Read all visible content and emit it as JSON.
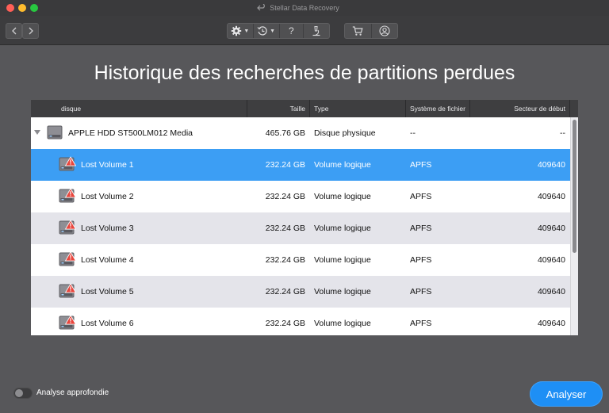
{
  "window": {
    "title": "Stellar Data Recovery"
  },
  "toolbar": {
    "back_icon": "chevron-left-icon",
    "forward_icon": "chevron-right-icon",
    "settings_icon": "gear-icon",
    "history_icon": "history-clock-icon",
    "help_label": "?",
    "tools_icon": "microscope-icon",
    "cart_icon": "cart-icon",
    "account_icon": "user-icon"
  },
  "page": {
    "heading": "Historique des recherches de partitions perdues"
  },
  "table": {
    "columns": [
      "disque",
      "Taille",
      "Type",
      "Système de fichier",
      "Secteur de début"
    ],
    "rows": [
      {
        "name": "APPLE HDD ST500LM012 Media",
        "size": "465.76 GB",
        "type": "Disque physique",
        "fs": "--",
        "start": "--",
        "kind": "disk",
        "selected": false
      },
      {
        "name": "Lost Volume 1",
        "size": "232.24 GB",
        "type": "Volume logique",
        "fs": "APFS",
        "start": "409640",
        "kind": "volume",
        "selected": true
      },
      {
        "name": "Lost Volume 2",
        "size": "232.24 GB",
        "type": "Volume logique",
        "fs": "APFS",
        "start": "409640",
        "kind": "volume",
        "selected": false
      },
      {
        "name": "Lost Volume 3",
        "size": "232.24 GB",
        "type": "Volume logique",
        "fs": "APFS",
        "start": "409640",
        "kind": "volume",
        "selected": false
      },
      {
        "name": "Lost Volume 4",
        "size": "232.24 GB",
        "type": "Volume logique",
        "fs": "APFS",
        "start": "409640",
        "kind": "volume",
        "selected": false
      },
      {
        "name": "Lost Volume 5",
        "size": "232.24 GB",
        "type": "Volume logique",
        "fs": "APFS",
        "start": "409640",
        "kind": "volume",
        "selected": false
      },
      {
        "name": "Lost Volume 6",
        "size": "232.24 GB",
        "type": "Volume logique",
        "fs": "APFS",
        "start": "409640",
        "kind": "volume",
        "selected": false
      }
    ]
  },
  "footer": {
    "deep_scan_label": "Analyse approfondie",
    "deep_scan_enabled": false,
    "analyze_label": "Analyser"
  },
  "colors": {
    "accent": "#1e8ff5",
    "selection": "#3c9ef4",
    "warning": "#e8453c"
  }
}
